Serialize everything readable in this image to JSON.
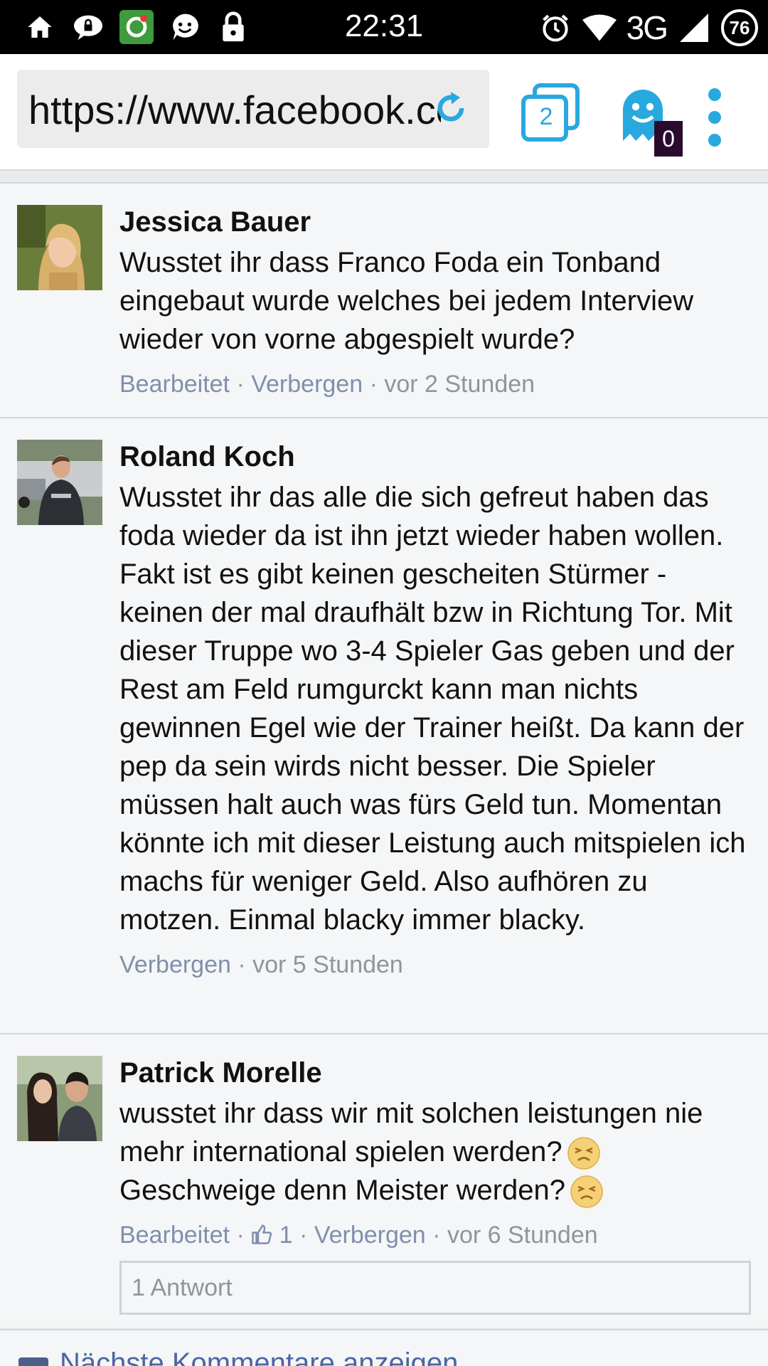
{
  "status_bar": {
    "time": "22:31",
    "network": "3G",
    "battery": "76",
    "icons_left": [
      "home-icon",
      "chat-lock-icon",
      "app-icon",
      "smiley-icon",
      "lock-icon"
    ],
    "icons_right": [
      "alarm-icon",
      "wifi-icon",
      "signal-icon",
      "battery-icon"
    ]
  },
  "browser": {
    "url": "https://www.facebook.com",
    "tab_count": "2",
    "ghost_badge": "0",
    "accent_color": "#29a8e0"
  },
  "comments": [
    {
      "author": "Jessica Bauer",
      "text": "Wusstet ihr dass Franco Foda ein Tonband eingebaut wurde welches bei jedem Interview wieder von vorne abgespielt wurde?",
      "edited": "Bearbeitet",
      "hide": "Verbergen",
      "time": "vor 2 Stunden"
    },
    {
      "author": "Roland Koch",
      "text": "Wusstet ihr das alle die sich gefreut haben das foda wieder da ist ihn jetzt wieder haben wollen. Fakt ist es gibt keinen gescheiten Stürmer - keinen der mal draufhält bzw in Richtung Tor. Mit dieser Truppe wo 3-4 Spieler Gas geben und der Rest am Feld rumgurckt kann man nichts gewinnen Egel wie der Trainer heißt. Da kann der pep da sein wirds nicht besser. Die Spieler müssen halt auch was fürs Geld tun. Momentan könnte ich mit dieser Leistung auch mitspielen ich machs für weniger Geld. Also aufhören zu motzen. Einmal blacky immer blacky.",
      "hide": "Verbergen",
      "time": "vor 5 Stunden"
    },
    {
      "author": "Patrick Morelle",
      "text_line1": "wusstet ihr dass wir mit solchen leistungen nie mehr international spielen werden?",
      "text_line2": "Geschweige denn Meister werden?",
      "edited": "Bearbeitet",
      "likes": "1",
      "hide": "Verbergen",
      "time": "vor 6 Stunden",
      "replies": "1 Antwort"
    }
  ],
  "footer": {
    "more_comments": "Nächste Kommentare anzeigen"
  }
}
